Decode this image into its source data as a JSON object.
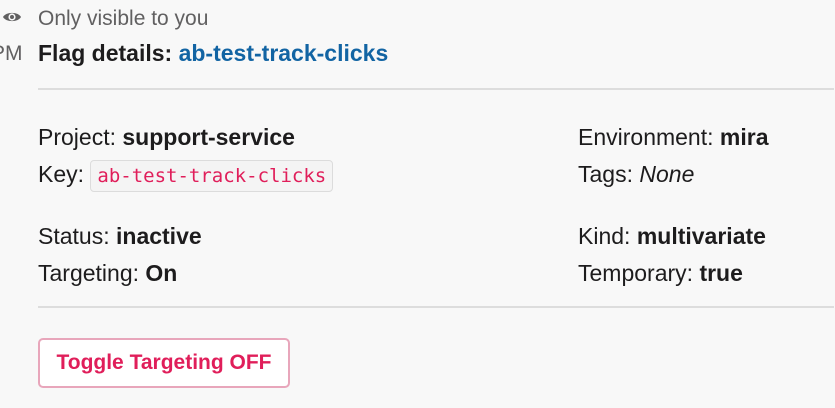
{
  "header": {
    "visibility_note": "Only visible to you",
    "timestamp_fragment": "PM",
    "title_prefix": "Flag details:",
    "flag_name": "ab-test-track-clicks"
  },
  "details": {
    "project_label": "Project:",
    "project_value": "support-service",
    "key_label": "Key:",
    "key_value": "ab-test-track-clicks",
    "environment_label": "Environment:",
    "environment_value": "mira",
    "tags_label": "Tags:",
    "tags_value": "None",
    "status_label": "Status:",
    "status_value": "inactive",
    "targeting_label": "Targeting:",
    "targeting_value": "On",
    "kind_label": "Kind:",
    "kind_value": "multivariate",
    "temporary_label": "Temporary:",
    "temporary_value": "true"
  },
  "actions": {
    "toggle_label": "Toggle Targeting OFF"
  },
  "colors": {
    "link": "#1264a3",
    "danger": "#e01e5a",
    "muted": "#616061",
    "divider": "#dddddd"
  },
  "icons": {
    "visibility": "eye-icon"
  }
}
